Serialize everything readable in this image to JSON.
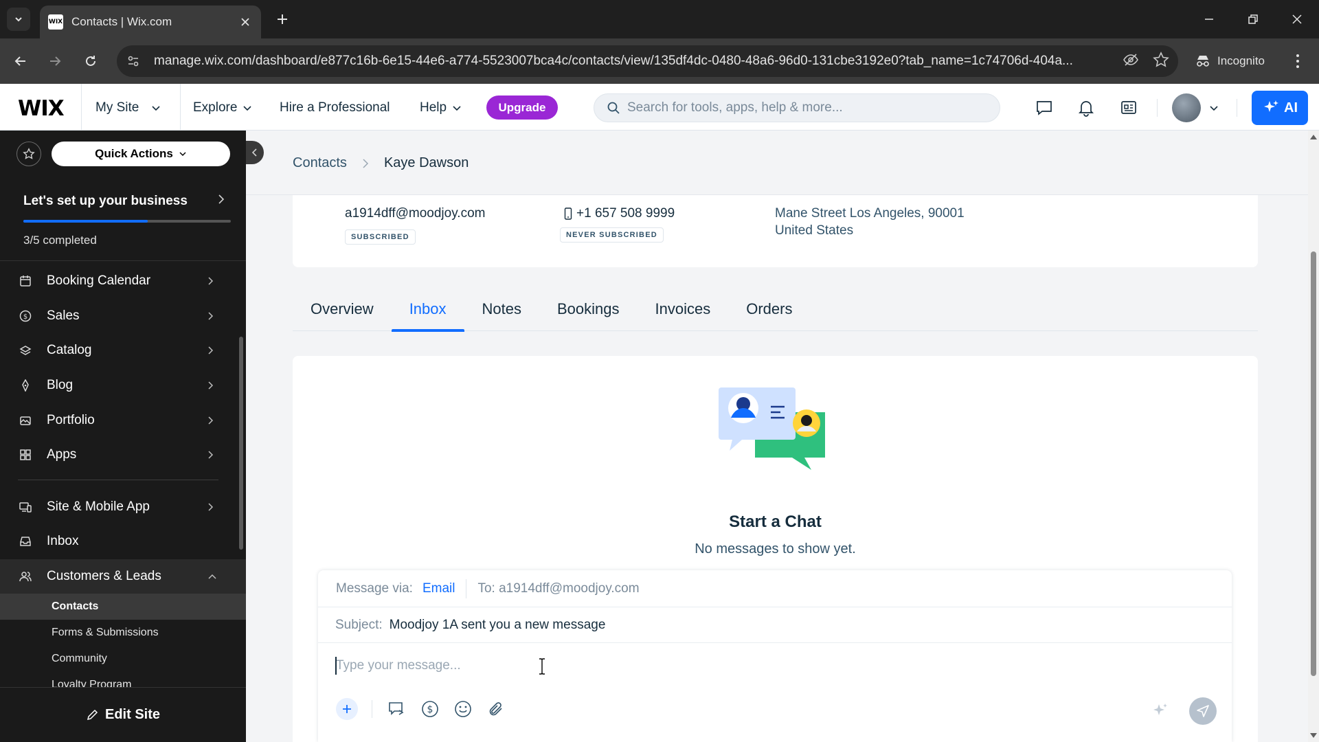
{
  "browser": {
    "tab_title": "Contacts | Wix.com",
    "favicon_text": "WIX",
    "url": "manage.wix.com/dashboard/e877c16b-6e15-44e6-a774-5523007bca4c/contacts/view/135df4dc-0480-48a6-96d0-131cbe3192e0?tab_name=1c74706d-404a...",
    "incognito_label": "Incognito"
  },
  "topbar": {
    "logo": "WIX",
    "my_site": "My Site",
    "explore": "Explore",
    "hire": "Hire a Professional",
    "help": "Help",
    "upgrade": "Upgrade",
    "search_placeholder": "Search for tools, apps, help & more...",
    "ai_label": "AI"
  },
  "sidebar": {
    "quick_actions": "Quick Actions",
    "setup_title": "Let's set up your business",
    "setup_progress": 0.6,
    "setup_count": "3/5 completed",
    "items": [
      {
        "label": "Booking Calendar",
        "icon": "calendar-icon"
      },
      {
        "label": "Sales",
        "icon": "dollar-icon"
      },
      {
        "label": "Catalog",
        "icon": "catalog-icon"
      },
      {
        "label": "Blog",
        "icon": "pen-icon"
      },
      {
        "label": "Portfolio",
        "icon": "portfolio-icon"
      },
      {
        "label": "Apps",
        "icon": "apps-icon"
      }
    ],
    "items2": [
      {
        "label": "Site & Mobile App",
        "icon": "devices-icon"
      },
      {
        "label": "Inbox",
        "icon": "inbox-icon"
      },
      {
        "label": "Customers & Leads",
        "icon": "customers-icon"
      }
    ],
    "sub_items": [
      "Contacts",
      "Forms & Submissions",
      "Community",
      "Loyalty Program"
    ],
    "edit_site": "Edit Site"
  },
  "breadcrumb": {
    "parent": "Contacts",
    "current": "Kaye Dawson"
  },
  "contact": {
    "email": "a1914dff@moodjoy.com",
    "email_status": "SUBSCRIBED",
    "phone": "+1 657 508 9999",
    "phone_status": "NEVER SUBSCRIBED",
    "address_line1": "Mane Street Los Angeles, 90001",
    "address_line2": "United States"
  },
  "tabs": [
    "Overview",
    "Inbox",
    "Notes",
    "Bookings",
    "Invoices",
    "Orders"
  ],
  "active_tab": "Inbox",
  "inbox": {
    "title": "Start a Chat",
    "subtitle": "No messages to show yet.",
    "via_label": "Message via:",
    "via_value": "Email",
    "to": "To: a1914dff@moodjoy.com",
    "subject_label": "Subject:",
    "subject_value": "Moodjoy 1A sent you a new message",
    "message_placeholder": "Type your message..."
  },
  "colors": {
    "accent": "#116dff",
    "upgrade": "#9a27d5",
    "sidebar_bg": "#1a1a1a"
  }
}
